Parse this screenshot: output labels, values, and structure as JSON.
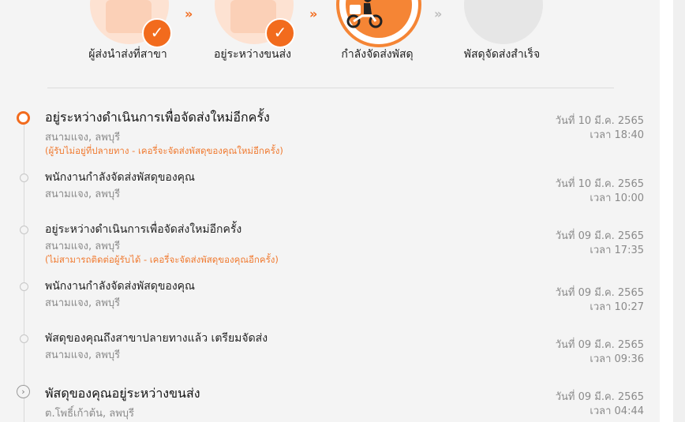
{
  "stepper": {
    "steps": [
      {
        "label": "ผู้ส่งนำส่งที่สาขา",
        "status": "done",
        "icon": "parcel-box-icon"
      },
      {
        "label": "อยู่ระหว่างขนส่ง",
        "status": "done",
        "icon": "delivery-truck-icon"
      },
      {
        "label": "กำลังจัดส่งพัสดุ",
        "status": "current",
        "icon": "scooter-rider-icon"
      },
      {
        "label": "พัสดุจัดส่งสำเร็จ",
        "status": "pending",
        "icon": "delivered-package-icon"
      }
    ],
    "check_glyph": "✓",
    "arrow_glyph": "»",
    "colors": {
      "accent": "#f26b1d",
      "accent_light": "#fde2d2",
      "pending": "#e6e6e6",
      "arrow_done": "#f26b1d",
      "arrow_pending": "#bdbdbd"
    }
  },
  "timeline": {
    "events": [
      {
        "title": "อยู่ระหว่างดำเนินการเพื่อจัดส่งใหม่อีกครั้ง",
        "location": "สนามแจง, ลพบุรี",
        "note": "(ผู้รับไม่อยู่ที่ปลายทาง - เคอรี่จะจัดส่งพัสดุของคุณใหม่อีกครั้ง)",
        "date": "วันที่ 10 มี.ค. 2565",
        "time": "เวลา 18:40"
      },
      {
        "title": "พนักงานกำลังจัดส่งพัสดุของคุณ",
        "location": "สนามแจง, ลพบุรี",
        "note": "",
        "date": "วันที่ 10 มี.ค. 2565",
        "time": "เวลา 10:00"
      },
      {
        "title": "อยู่ระหว่างดำเนินการเพื่อจัดส่งใหม่อีกครั้ง",
        "location": "สนามแจง, ลพบุรี",
        "note": "(ไม่สามารถติดต่อผู้รับได้ - เคอรี่จะจัดส่งพัสดุของคุณอีกครั้ง)",
        "date": "วันที่ 09 มี.ค. 2565",
        "time": "เวลา 17:35"
      },
      {
        "title": "พนักงานกำลังจัดส่งพัสดุของคุณ",
        "location": "สนามแจง, ลพบุรี",
        "note": "",
        "date": "วันที่ 09 มี.ค. 2565",
        "time": "เวลา 10:27"
      },
      {
        "title": "พัสดุของคุณถึงสาขาปลายทางแล้ว เตรียมจัดส่ง",
        "location": "สนามแจง, ลพบุรี",
        "note": "",
        "date": "วันที่ 09 มี.ค. 2565",
        "time": "เวลา 09:36"
      },
      {
        "title": "พัสดุของคุณอยู่ระหว่างขนส่ง",
        "location": "ต.โพธิ์เก้าต้น, ลพบุรี",
        "note": "",
        "date": "วันที่ 09 มี.ค. 2565",
        "time": "เวลา 04:44"
      }
    ],
    "transit_glyph": "›"
  }
}
